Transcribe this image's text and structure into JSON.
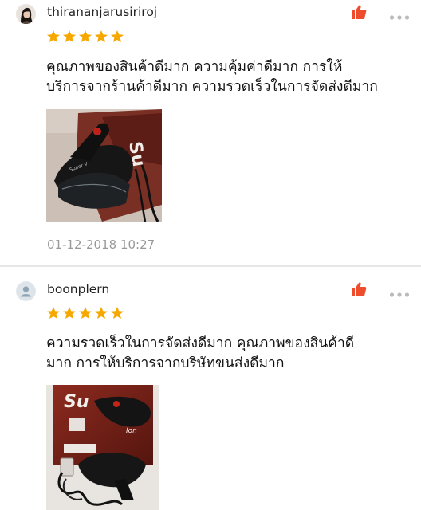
{
  "reviews": [
    {
      "username": "thirananjarusiriroj",
      "rating": 5,
      "text_lines": [
        "คุณภาพของสินค้าดีมาก ความคุ้มค่าดีมาก การให้",
        "บริการจากร้านค้าดีมาก ความรวดเร็วในการจัดส่งดีมาก"
      ],
      "photo": {
        "brand_text": "Su",
        "alt": "hair dryer product photo"
      },
      "timestamp": "01-12-2018 10:27",
      "icons": {
        "avatar": "user-photo-avatar",
        "like": "thumbs-up-icon",
        "more": "more-options-icon"
      }
    },
    {
      "username": "boonplern",
      "rating": 5,
      "text_lines": [
        "ความรวดเร็วในการจัดส่งดีมาก คุณภาพของสินค้าดี",
        "มาก การให้บริการจากบริษัทขนส่งดีมาก"
      ],
      "photo": {
        "brand_text": "Su",
        "alt": "hair dryer with box photo"
      },
      "icons": {
        "avatar": "default-user-icon",
        "like": "thumbs-up-icon",
        "more": "more-options-icon"
      }
    }
  ],
  "colors": {
    "star": "#f6a700",
    "like": "#ee4d2d",
    "more": "#bbbbbb",
    "timestamp": "#999999",
    "divider": "#e6e6e6"
  }
}
